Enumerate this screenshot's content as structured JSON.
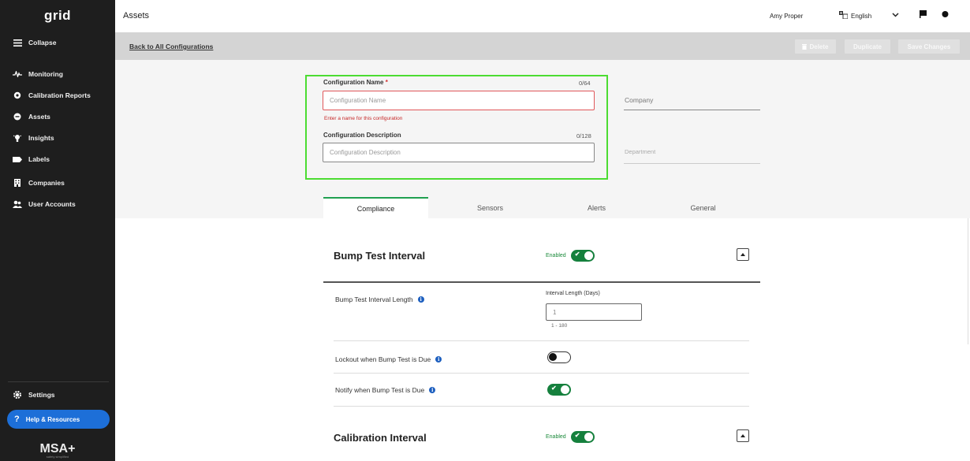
{
  "sidebar": {
    "logo": "grid",
    "collapse_label": "Collapse",
    "items": [
      {
        "label": "Monitoring",
        "icon": "pulse-icon"
      },
      {
        "label": "Calibration Reports",
        "icon": "gear-report-icon"
      },
      {
        "label": "Assets",
        "icon": "assets-icon"
      },
      {
        "label": "Insights",
        "icon": "lightbulb-icon"
      },
      {
        "label": "Labels",
        "icon": "label-icon"
      },
      {
        "label": "Companies",
        "icon": "building-icon"
      },
      {
        "label": "User Accounts",
        "icon": "users-icon"
      }
    ],
    "settings_label": "Settings",
    "help_label": "Help & Resources",
    "brand": "MSA+",
    "brand_sub": "safety simplified"
  },
  "topbar": {
    "page_title": "Assets",
    "user_name": "Amy Proper",
    "language": "English"
  },
  "actionbar": {
    "back_link": "Back to All Configurations",
    "delete_label": "Delete",
    "duplicate_label": "Duplicate",
    "save_label": "Save Changes"
  },
  "form": {
    "name_label": "Configuration Name",
    "name_required": "*",
    "name_counter": "0/64",
    "name_placeholder": "Configuration Name",
    "name_error": "Enter a name for this configuration",
    "desc_label": "Configuration Description",
    "desc_counter": "0/128",
    "desc_placeholder": "Configuration Description",
    "company_label": "Company",
    "department_label": "Department"
  },
  "tabs": [
    "Compliance",
    "Sensors",
    "Alerts",
    "General"
  ],
  "active_tab": "Compliance",
  "bump_section": {
    "title": "Bump Test Interval",
    "enabled_label": "Enabled",
    "interval_row_label": "Bump Test Interval Length",
    "interval_field_label": "Interval Length (Days)",
    "interval_value": "1",
    "interval_range": "1 - 180",
    "lockout_label": "Lockout when Bump Test is Due",
    "lockout_enabled": false,
    "notify_label": "Notify when Bump Test is Due",
    "notify_enabled": true
  },
  "calibration_section": {
    "title": "Calibration Interval",
    "enabled_label": "Enabled"
  },
  "colors": {
    "sidebar_bg": "#1e1e1e",
    "accent_green": "#15803d",
    "highlight_box": "#4cdc32",
    "help_blue": "#1d6fd8",
    "error_red": "#c62828"
  }
}
